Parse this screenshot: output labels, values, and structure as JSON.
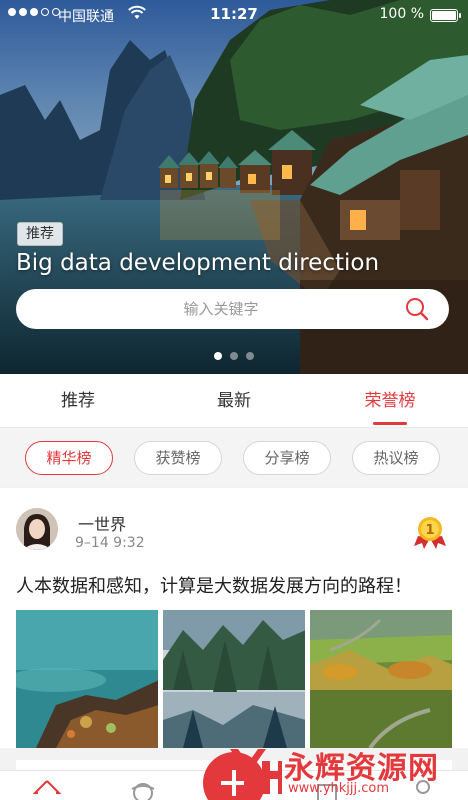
{
  "status_bar": {
    "carrier": "中国联通",
    "time": "11:27",
    "battery": "100 %"
  },
  "banner": {
    "tag": "推荐",
    "title": "Big data development direction",
    "search_placeholder": "输入关键字",
    "page_indicator": {
      "total": 3,
      "active": 1
    }
  },
  "tabs": [
    {
      "label": "推荐",
      "active": false
    },
    {
      "label": "最新",
      "active": false
    },
    {
      "label": "荣誉榜",
      "active": true
    }
  ],
  "filters": [
    {
      "label": "精华榜",
      "active": true
    },
    {
      "label": "获赞榜",
      "active": false
    },
    {
      "label": "分享榜",
      "active": false
    },
    {
      "label": "热议榜",
      "active": false
    }
  ],
  "post": {
    "author": "一世界",
    "timestamp": "9–14  9:32",
    "rank_badge": "1",
    "text": "人本数据和感知，计算是大数据发展方向的路程！"
  },
  "watermark": {
    "name": "永辉资源网",
    "url": "www.yhkjjj.com"
  },
  "colors": {
    "accent": "#e4393c",
    "background": "#f2f2f2"
  }
}
